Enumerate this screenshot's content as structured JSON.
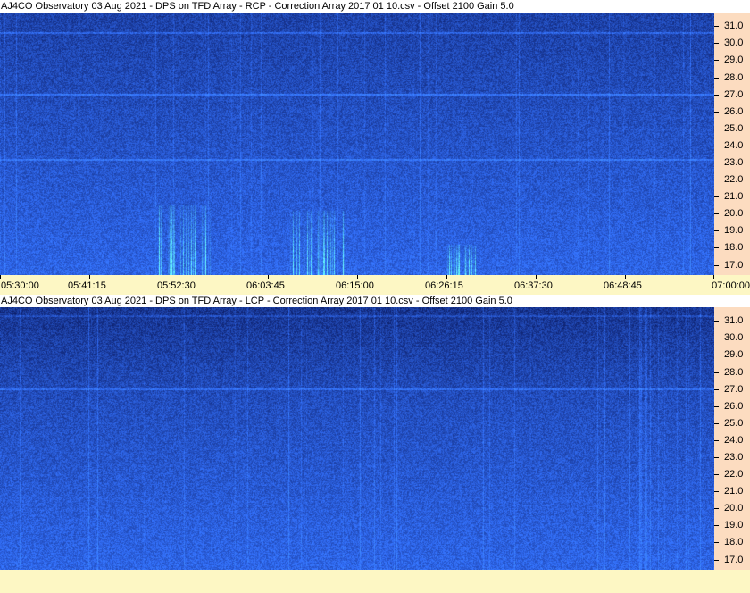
{
  "panels": [
    {
      "title": "AJ4CO Observatory 03 Aug 2021  -  DPS on TFD Array  -  RCP  -  Correction Array 2017 01 10.csv  -  Offset 2100  Gain 5.0",
      "polarization": "RCP",
      "has_time_axis": true
    },
    {
      "title": "AJ4CO Observatory 03 Aug 2021  -  DPS on TFD Array  -  LCP  -  Correction Array 2017 01 10.csv  -  Offset 2100  Gain 5.0",
      "polarization": "LCP",
      "has_time_axis": false
    }
  ],
  "frequency_axis": {
    "unit": "MHz",
    "labels": [
      "31.0",
      "30.0",
      "29.0",
      "28.0",
      "27.0",
      "26.0",
      "25.0",
      "24.0",
      "23.0",
      "22.0",
      "21.0",
      "20.0",
      "19.0",
      "18.0",
      "17.0"
    ],
    "range": [
      16.4,
      31.8
    ]
  },
  "time_axis": {
    "labels": [
      "05:30:00",
      "05:41:15",
      "05:52:30",
      "06:03:45",
      "06:15:00",
      "06:26:15",
      "06:37:30",
      "06:48:45",
      "07:00:00"
    ],
    "start": "05:30:00",
    "end": "07:00:00"
  },
  "colors": {
    "axis_background": "#fcdcc0",
    "time_axis_background": "#fdf7c4",
    "spectrogram_base": "#1e46d0",
    "burst_color": "#5ae6ff"
  },
  "features": {
    "rcp_bursts": [
      {
        "from": "05:50:00",
        "to": "05:56:30",
        "freq_top": 20.5
      },
      {
        "from": "06:06:30",
        "to": "06:13:30",
        "freq_top": 20.2
      },
      {
        "from": "06:26:00",
        "to": "06:30:00",
        "freq_top": 18.2
      }
    ]
  }
}
